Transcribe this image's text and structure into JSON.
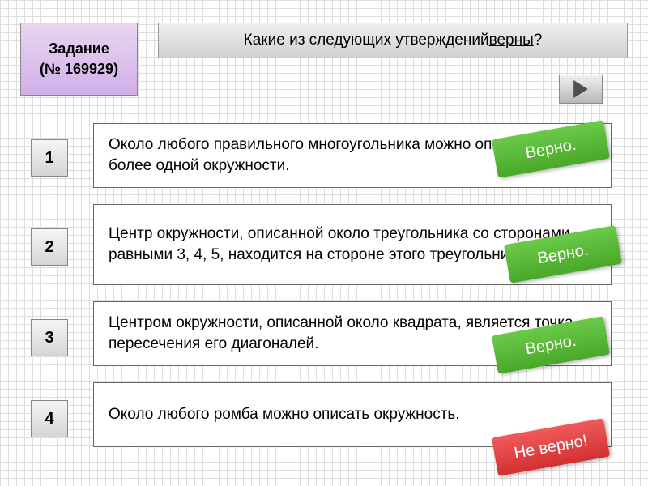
{
  "task": {
    "label": "Задание",
    "number": "(№ 169929)"
  },
  "question": {
    "prefix": "Какие из следующих утверждений ",
    "emphasis": "верны",
    "suffix": "?"
  },
  "options": [
    {
      "num": "1",
      "text": "Около любого правильного многоугольника можно описать не более одной окружности.",
      "badge": "Верно.",
      "correct": true
    },
    {
      "num": "2",
      "text": "Центр окружности, описанной около треугольника со сторонами, равными 3, 4, 5, находится на стороне этого треугольника.",
      "badge": "Верно.",
      "correct": true
    },
    {
      "num": "3",
      "text": "Центром окружности, описанной около квадрата, является точка пересечения его диагоналей.",
      "badge": "Верно.",
      "correct": true
    },
    {
      "num": "4",
      "text": "Около любого ромба можно описать окружность.",
      "badge": "Не верно!",
      "correct": false
    }
  ]
}
